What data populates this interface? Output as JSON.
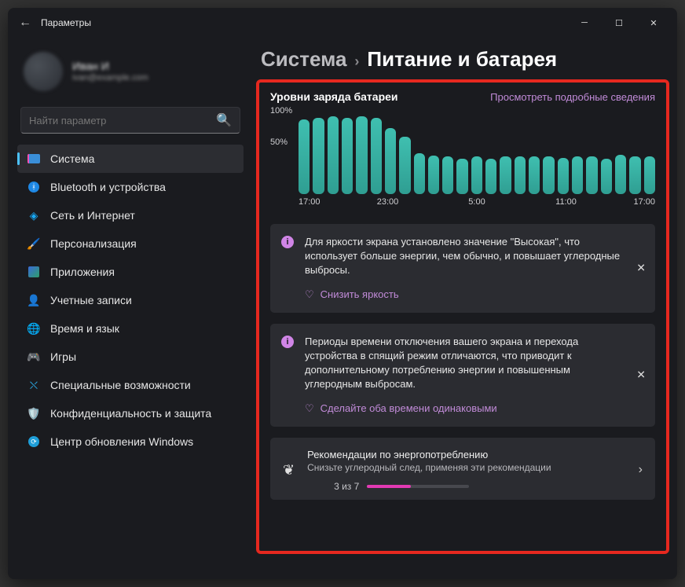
{
  "window": {
    "title": "Параметры"
  },
  "profile": {
    "name": "Иван И",
    "email": "ivan@example.com"
  },
  "search": {
    "placeholder": "Найти параметр"
  },
  "sidebar": {
    "items": [
      {
        "label": "Система"
      },
      {
        "label": "Bluetooth и устройства"
      },
      {
        "label": "Сеть и Интернет"
      },
      {
        "label": "Персонализация"
      },
      {
        "label": "Приложения"
      },
      {
        "label": "Учетные записи"
      },
      {
        "label": "Время и язык"
      },
      {
        "label": "Игры"
      },
      {
        "label": "Специальные возможности"
      },
      {
        "label": "Конфиденциальность и защита"
      },
      {
        "label": "Центр обновления Windows"
      }
    ]
  },
  "breadcrumb": {
    "parent": "Система",
    "current": "Питание и батарея"
  },
  "panel": {
    "title": "Уровни заряда батареи",
    "details_link": "Просмотреть подробные сведения"
  },
  "chart_data": {
    "type": "bar",
    "title": "Уровни заряда батареи",
    "xlabel": "",
    "ylabel": "",
    "ylim": [
      0,
      100
    ],
    "y_ticks": [
      "100%",
      "50%"
    ],
    "x_start": "17:00",
    "x_end": "17:00",
    "x_ticks": [
      "17:00",
      "23:00",
      "5:00",
      "11:00",
      "17:00"
    ],
    "values": [
      88,
      90,
      92,
      90,
      92,
      90,
      78,
      68,
      48,
      45,
      44,
      42,
      44,
      42,
      44,
      44,
      44,
      44,
      43,
      44,
      44,
      42,
      46,
      44,
      44
    ]
  },
  "tips": [
    {
      "text": "Для яркости экрана установлено значение \"Высокая\", что использует больше энергии, чем обычно, и повышает углеродные выбросы.",
      "action": "Снизить яркость"
    },
    {
      "text": "Периоды времени отключения вашего экрана и перехода устройства в спящий режим отличаются, что приводит к дополнительному потреблению энергии и повышенным углеродным выбросам.",
      "action": "Сделайте оба времени одинаковыми"
    }
  ],
  "reco": {
    "title": "Рекомендации по энергопотреблению",
    "subtitle": "Снизьте углеродный след, применяя эти рекомендации",
    "progress_label": "3 из 7",
    "progress_done": 3,
    "progress_total": 7
  }
}
